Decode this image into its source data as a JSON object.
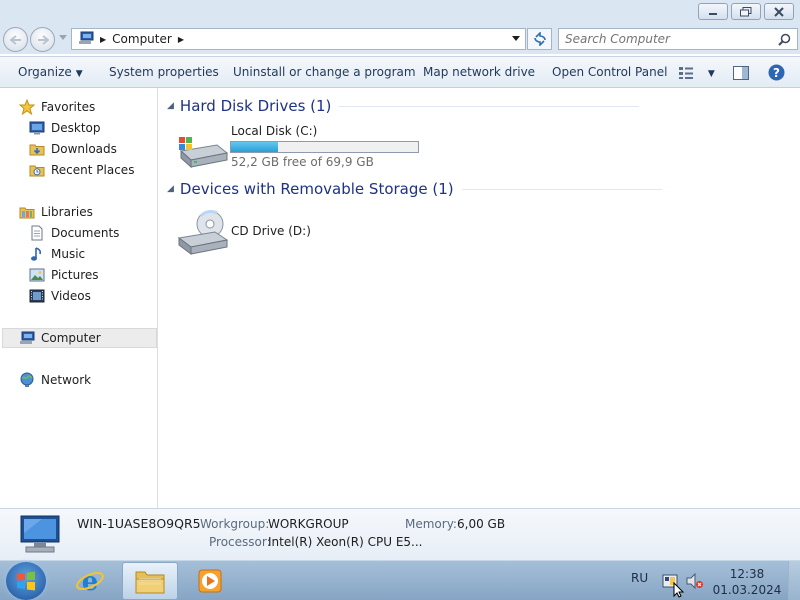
{
  "address": {
    "crumbs": [
      "Computer"
    ]
  },
  "search": {
    "placeholder": "Search Computer"
  },
  "toolbar": {
    "organize": "Organize",
    "system_properties": "System properties",
    "uninstall": "Uninstall or change a program",
    "map_drive": "Map network drive",
    "control_panel": "Open Control Panel"
  },
  "nav": {
    "favorites": {
      "label": "Favorites",
      "items": [
        "Desktop",
        "Downloads",
        "Recent Places"
      ]
    },
    "libraries": {
      "label": "Libraries",
      "items": [
        "Documents",
        "Music",
        "Pictures",
        "Videos"
      ]
    },
    "computer": "Computer",
    "network": "Network"
  },
  "content": {
    "groups": [
      {
        "title": "Hard Disk Drives (1)",
        "drives": [
          {
            "name": "Local Disk (C:)",
            "free_text": "52,2 GB free of 69,9 GB",
            "used_fraction": 0.253
          }
        ]
      },
      {
        "title": "Devices with Removable Storage (1)",
        "drives": [
          {
            "name": "CD Drive (D:)"
          }
        ]
      }
    ]
  },
  "details": {
    "computer_name": "WIN-1UASE8O9QR5",
    "workgroup_label": "Workgroup:",
    "workgroup": "WORKGROUP",
    "memory_label": "Memory:",
    "memory": "6,00 GB",
    "processor_label": "Processor:",
    "processor": "Intel(R) Xeon(R) CPU E5..."
  },
  "taskbar": {
    "language": "RU",
    "time": "12:38",
    "date": "01.03.2024"
  },
  "colors": {
    "accent_title": "#1e3287",
    "toolbar_text": "#1e395b",
    "disk_bar_fill": "#2a9fd4"
  }
}
